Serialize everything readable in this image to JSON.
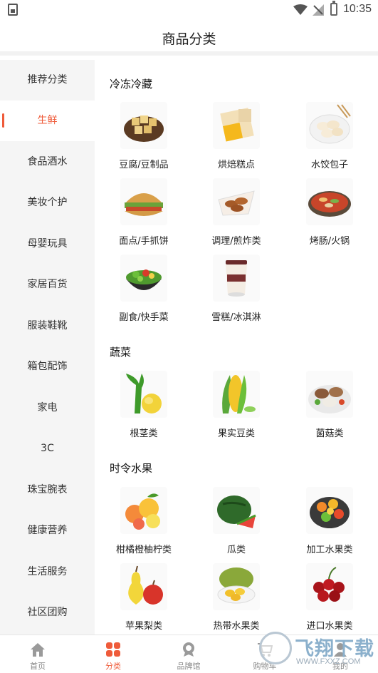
{
  "status_bar": {
    "time": "10:35"
  },
  "header": {
    "title": "商品分类"
  },
  "sidebar": {
    "items": [
      {
        "label": "推荐分类",
        "active": false
      },
      {
        "label": "生鲜",
        "active": true
      },
      {
        "label": "食品酒水",
        "active": false
      },
      {
        "label": "美妆个护",
        "active": false
      },
      {
        "label": "母婴玩具",
        "active": false
      },
      {
        "label": "家居百货",
        "active": false
      },
      {
        "label": "服装鞋靴",
        "active": false
      },
      {
        "label": "箱包配饰",
        "active": false
      },
      {
        "label": "家电",
        "active": false
      },
      {
        "label": "3C",
        "active": false
      },
      {
        "label": "珠宝腕表",
        "active": false
      },
      {
        "label": "健康营养",
        "active": false
      },
      {
        "label": "生活服务",
        "active": false
      },
      {
        "label": "社区团购",
        "active": false
      }
    ]
  },
  "sections": [
    {
      "title": "冷冻冷藏",
      "items": [
        {
          "label": "豆腐/豆制品",
          "icon": "tofu-image"
        },
        {
          "label": "烘焙糕点",
          "icon": "pastry-image"
        },
        {
          "label": "水饺包子",
          "icon": "dumpling-image"
        },
        {
          "label": "面点/手抓饼",
          "icon": "pancake-image"
        },
        {
          "label": "调理/煎炸类",
          "icon": "fried-food-image"
        },
        {
          "label": "烤肠/火锅",
          "icon": "hotpot-image"
        },
        {
          "label": "副食/快手菜",
          "icon": "salad-image"
        },
        {
          "label": "雪糕/冰淇淋",
          "icon": "ice-cream-image"
        }
      ]
    },
    {
      "title": "蔬菜",
      "items": [
        {
          "label": "根茎类",
          "icon": "root-vegetable-image"
        },
        {
          "label": "果实豆类",
          "icon": "corn-image"
        },
        {
          "label": "菌菇类",
          "icon": "mushroom-image"
        }
      ]
    },
    {
      "title": "时令水果",
      "items": [
        {
          "label": "柑橘橙柚柠类",
          "icon": "citrus-image"
        },
        {
          "label": "瓜类",
          "icon": "watermelon-image"
        },
        {
          "label": "加工水果类",
          "icon": "fruit-platter-image"
        },
        {
          "label": "苹果梨类",
          "icon": "apple-pear-image"
        },
        {
          "label": "热带水果类",
          "icon": "jackfruit-image"
        },
        {
          "label": "进口水果类",
          "icon": "cherry-image"
        }
      ]
    }
  ],
  "tabbar": {
    "tabs": [
      {
        "label": "首页",
        "icon": "home-icon",
        "active": false
      },
      {
        "label": "分类",
        "icon": "category-icon",
        "active": true
      },
      {
        "label": "品牌馆",
        "icon": "brand-icon",
        "active": false
      },
      {
        "label": "购物车",
        "icon": "cart-icon",
        "active": false
      },
      {
        "label": "我的",
        "icon": "profile-icon",
        "active": false
      }
    ]
  },
  "watermark": {
    "text": "飞翔下载",
    "url": "WWW.FXXZ.COM"
  },
  "colors": {
    "accent": "#ef5b3a",
    "sidebar_bg": "#f5f5f5"
  }
}
